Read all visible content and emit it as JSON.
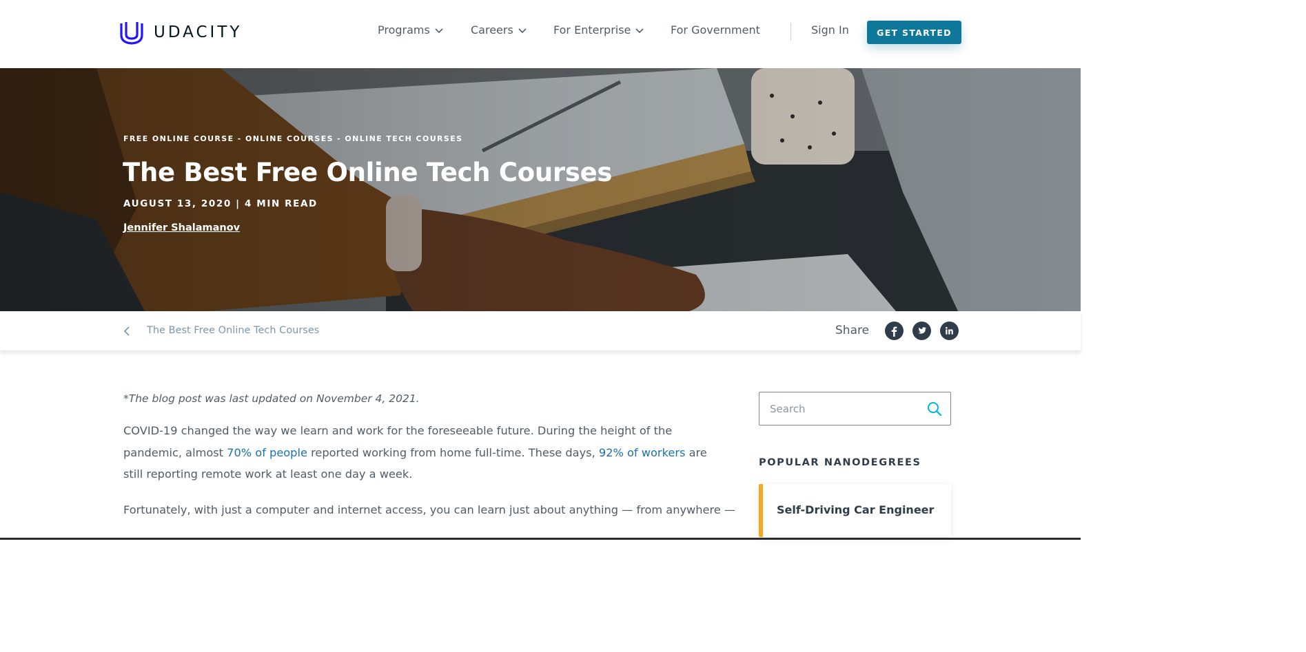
{
  "header": {
    "brand": "UDACITY",
    "nav": [
      {
        "label": "Programs",
        "has_dropdown": true
      },
      {
        "label": "Careers",
        "has_dropdown": true
      },
      {
        "label": "For Enterprise",
        "has_dropdown": true
      },
      {
        "label": "For Government",
        "has_dropdown": false
      }
    ],
    "sign_in": "Sign In",
    "cta": "GET STARTED",
    "colors": {
      "brand_blue": "#2015ff",
      "cta": "#0f779a"
    }
  },
  "hero": {
    "breadcrumb": "FREE ONLINE COURSE - ONLINE COURSES - ONLINE TECH COURSES",
    "title": "The Best Free Online Tech Courses",
    "meta": "AUGUST 13, 2020 | 4 MIN READ",
    "author": "Jennifer Shalamanov"
  },
  "subbar": {
    "back_icon": "chevron-left-icon",
    "title": "The Best Free Online Tech Courses",
    "share_label": "Share",
    "share_icons": [
      "facebook-icon",
      "twitter-icon",
      "linkedin-icon"
    ]
  },
  "article": {
    "updated": "*The blog post was last updated on November 4, 2021.",
    "para1_a": "COVID-19 changed the way we learn and work for the foreseeable future. During the height of the pandemic, almost ",
    "para1_link1": "70% of people",
    "para1_b": " reported working from home full-time. These days, ",
    "para1_link2": "92% of workers",
    "para1_c": " are still reporting remote work at least one day a week.",
    "para2": "Fortunately, with just a computer and internet access, you can learn just about anything — from anywhere —"
  },
  "sidebar": {
    "search_placeholder": "Search",
    "popular_title": "POPULAR NANODEGREES",
    "nanodegrees": [
      "Self-Driving Car Engineer"
    ],
    "accent": "#f5a623"
  }
}
